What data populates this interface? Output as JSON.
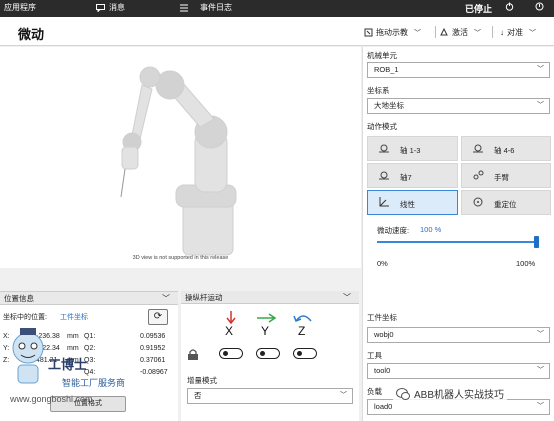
{
  "topbar": {
    "app_menu": "应用程序",
    "messages": "消息",
    "event_log": "事件日志",
    "status": "已停止"
  },
  "header": {
    "title": "微动",
    "jog_teach": "拖动示教",
    "activate": "激活",
    "align": "对准"
  },
  "viewport": {
    "message": "3D view is not supported in this release"
  },
  "settings": {
    "mech_unit_label": "机械单元",
    "mech_unit_value": "ROB_1",
    "coord_label": "坐标系",
    "coord_value": "大地坐标",
    "motion_mode_label": "动作模式",
    "modes": [
      {
        "label": "轴 1-3"
      },
      {
        "label": "轴 4-6"
      },
      {
        "label": "轴7"
      },
      {
        "label": "手臂"
      },
      {
        "label": "线性"
      },
      {
        "label": "重定位"
      }
    ],
    "speed_label": "微动速度:",
    "speed_value": "100 %",
    "speed_fraction": 1.0,
    "speed_min": "0%",
    "speed_max": "100%",
    "work_obj_label": "工件坐标",
    "work_obj_value": "wobj0",
    "tool_label": "工具",
    "tool_value": "tool0",
    "load_label": "负载",
    "load_value": "load0"
  },
  "position_panel": {
    "header": "位置信息",
    "pos_in_label": "坐标中的位置:",
    "pos_in_value": "工件坐标",
    "rows": [
      {
        "axis": "X:",
        "value": "-236.38",
        "unit": "mm",
        "q": "Q1:",
        "qv": "0.09536"
      },
      {
        "axis": "Y:",
        "value": "-122.34",
        "unit": "mm",
        "q": "Q2:",
        "qv": "0.91952"
      },
      {
        "axis": "Z:",
        "value": "481.21",
        "unit": "mm",
        "q": "Q3:",
        "qv": "0.37061"
      },
      {
        "axis": "",
        "value": "",
        "unit": "",
        "q": "Q4:",
        "qv": "-0.08967"
      }
    ],
    "format_button": "位置格式"
  },
  "joystick_panel": {
    "header": "操纵杆运动",
    "axes": [
      "X",
      "Y",
      "Z"
    ],
    "increment_label": "增量模式",
    "increment_value": "否"
  },
  "watermark": {
    "site_cn": "智能工厂服务商",
    "site_en": "www.gongboshi.com",
    "brand": "ABB机器人实战技巧",
    "logo_text": "工博士"
  },
  "colors": {
    "accent": "#3a86d8",
    "x_arrow": "#d0352e",
    "y_arrow": "#3aa84a",
    "z_arrow": "#2a7cd0"
  }
}
